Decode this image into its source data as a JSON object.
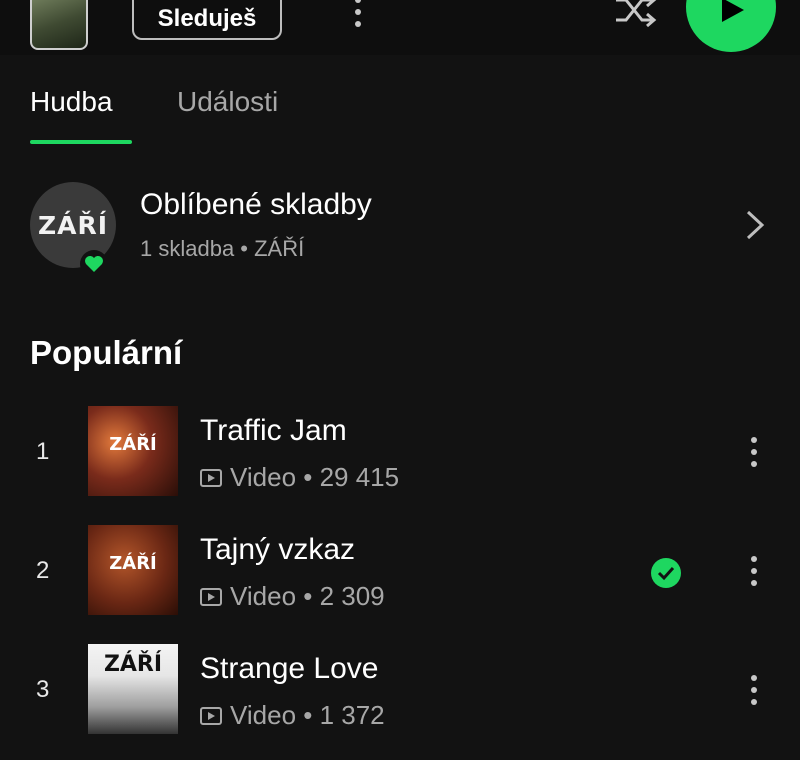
{
  "header": {
    "follow_label": "Sleduješ"
  },
  "tabs": [
    {
      "label": "Hudba",
      "active": true
    },
    {
      "label": "Události",
      "active": false
    }
  ],
  "liked": {
    "title": "Oblíbené skladby",
    "subtitle": "1 skladba • ZÁŘÍ",
    "avatar_text": "ZÁŘÍ"
  },
  "popular": {
    "title": "Populární",
    "tracks": [
      {
        "num": "1",
        "title": "Traffic Jam",
        "meta": "Video • 29 415",
        "cover_text": "ZÁŘÍ",
        "downloaded": false
      },
      {
        "num": "2",
        "title": "Tajný vzkaz",
        "meta": "Video • 2 309",
        "cover_text": "ZÁŘÍ",
        "downloaded": true
      },
      {
        "num": "3",
        "title": "Strange Love",
        "meta": "Video • 1 372",
        "cover_text": "ZÁŘÍ",
        "downloaded": false
      }
    ]
  },
  "colors": {
    "accent": "#1ed760",
    "background": "#121212",
    "muted_text": "#a7a7a7"
  },
  "icons": [
    "more-vertical-icon",
    "shuffle-icon",
    "play-icon",
    "heart-icon",
    "chevron-right-icon",
    "video-icon",
    "downloaded-check-icon"
  ]
}
